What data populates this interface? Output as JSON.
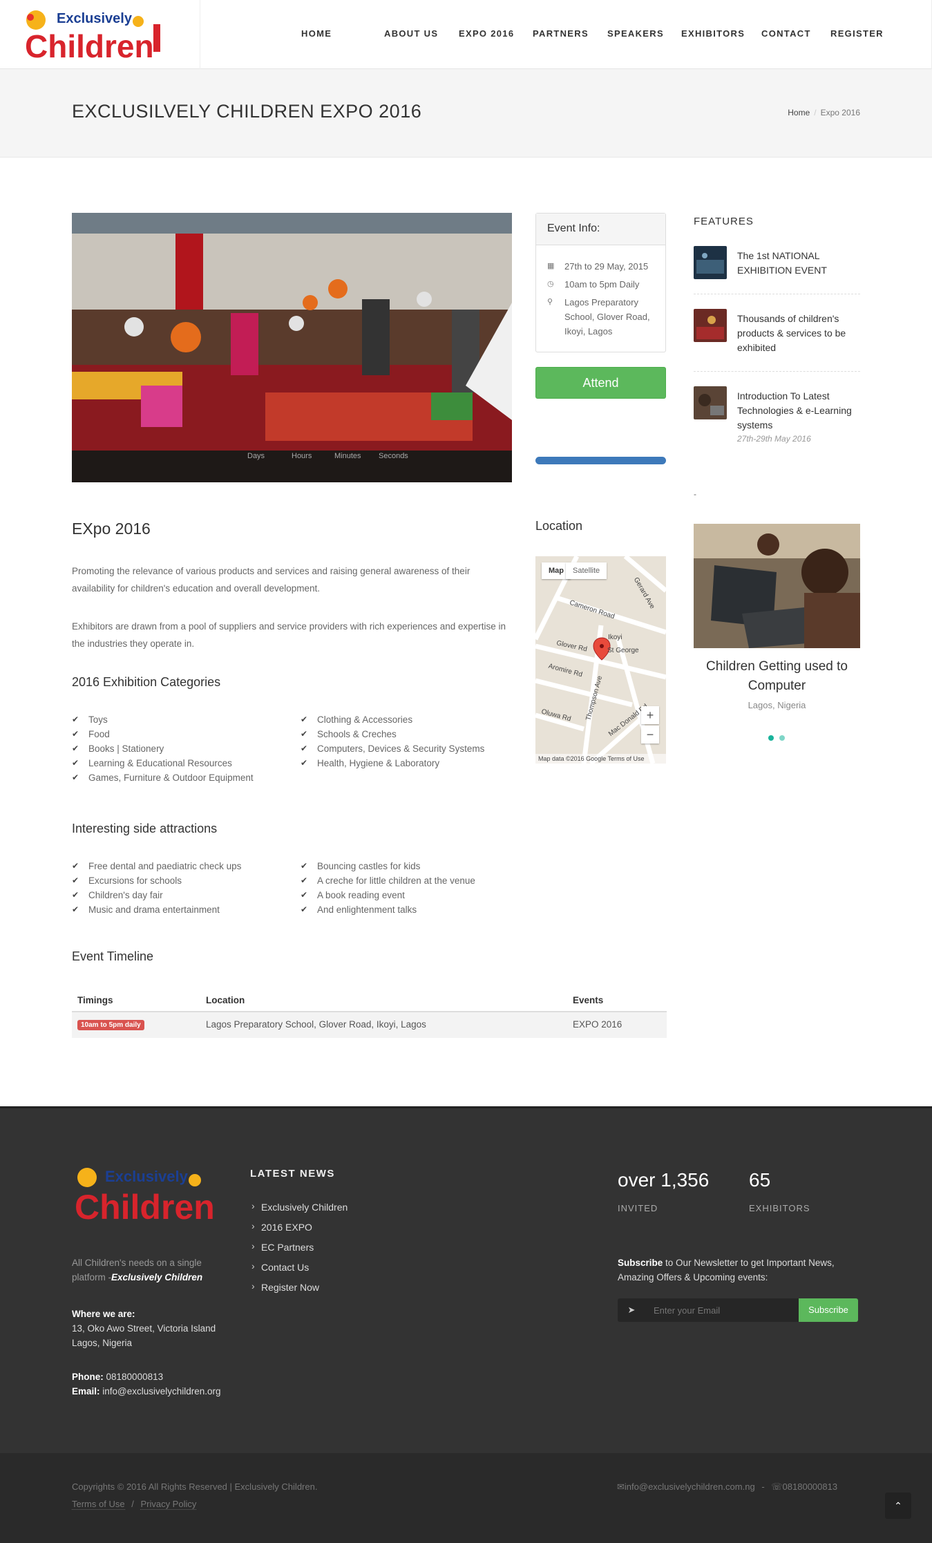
{
  "brand": {
    "logo_word": "Children",
    "logo_prefix": "Exclusively"
  },
  "nav": [
    "HOME",
    "ABOUT US",
    "EXPO 2016",
    "PARTNERS",
    "SPEAKERS",
    "EXHIBITORS",
    "CONTACT",
    "REGISTER"
  ],
  "page": {
    "title": "EXCLUSILVELY CHILDREN EXPO 2016",
    "breadcrumb_home": "Home",
    "breadcrumb_current": "Expo 2016"
  },
  "hero": {
    "countdown_labels": [
      "Days",
      "Hours",
      "Minutes",
      "Seconds"
    ]
  },
  "event_info": {
    "title": "Event Info:",
    "date": "27th to 29 May, 2015",
    "time": "10am to 5pm Daily",
    "address": "Lagos Preparatory School, Glover Road, Ikoyi, Lagos"
  },
  "attend_label": "Attend",
  "features": {
    "title": "FEATURES",
    "items": [
      {
        "text": "The 1st NATIONAL EXHIBITION EVENT"
      },
      {
        "text": "Thousands of children's products & services to be exhibited"
      },
      {
        "text": "Introduction To Latest Technologies & e-Learning systems",
        "date": "27th-29th May 2016"
      }
    ],
    "dash": "-"
  },
  "expo": {
    "title": "EXpo 2016",
    "para1": "Promoting the relevance of various products and services and raising general awareness of their availability for children's education and overall development.",
    "para2": "Exhibitors are drawn from a pool of suppliers and service providers with rich experiences and expertise in the industries they operate in."
  },
  "categories": {
    "title": "2016 Exhibition Categories",
    "left": [
      "Toys",
      "Food",
      "Books | Stationery",
      "Learning & Educational Resources",
      "Games, Furniture & Outdoor Equipment"
    ],
    "right": [
      "Clothing & Accessories",
      "Schools & Creches",
      "Computers, Devices & Security Systems",
      "Health, Hygiene & Laboratory"
    ]
  },
  "attractions": {
    "title": "Interesting side attractions",
    "left": [
      "Free dental and paediatric check ups",
      "Excursions for schools",
      "Children's day fair",
      "Music and drama entertainment"
    ],
    "right": [
      "Bouncing castles for kids",
      "A creche for little children at the venue",
      "A book reading event",
      "And enlightenment talks"
    ]
  },
  "location": {
    "title": "Location",
    "map_tab": "Map",
    "satellite_tab": "Satellite",
    "streets": [
      "Cameron Road",
      "Glover Rd",
      "Aromire Rd",
      "Thompson Ave",
      "Oluwa Rd",
      "Mac Donald Rd",
      "Gerard Ave",
      "Ikoyi",
      "St George"
    ],
    "zoom_in": "+",
    "zoom_out": "−",
    "map_footer": "Map data ©2016 Google   Terms of Use"
  },
  "slider": {
    "caption": "Children Getting used to Computer",
    "location": "Lagos, Nigeria"
  },
  "timeline": {
    "title": "Event Timeline",
    "headers": [
      "Timings",
      "Location",
      "Events"
    ],
    "row": {
      "badge": "10am to 5pm daily",
      "location": "Lagos Preparatory School, Glover Road, Ikoyi, Lagos",
      "event": "EXPO 2016"
    }
  },
  "footer": {
    "about": "All Children's needs on a single platform -",
    "about_em": "Exclusively Children",
    "where_label": "Where we are:",
    "address1": "13, Oko Awo Street, Victoria Island",
    "address2": "Lagos, Nigeria",
    "phone_label": "Phone:",
    "phone": "08180000813",
    "email_label": "Email:",
    "email": "info@exclusivelychildren.org",
    "news_title": "LATEST NEWS",
    "news": [
      "Exclusively Children",
      "2016 EXPO",
      "EC Partners",
      "Contact Us",
      "Register Now"
    ],
    "stat1_num": "over 1,356",
    "stat1_label": "INVITED",
    "stat2_num": "65",
    "stat2_label": "EXHIBITORS",
    "subscribe_bold": "Subscribe",
    "subscribe_text": "to Our Newsletter to get Important News, Amazing Offers & Upcoming events:",
    "email_placeholder": "Enter your Email",
    "subscribe_btn": "Subscribe"
  },
  "copyright": {
    "text": "Copyrights © 2016 All Rights Reserved | Exclusively Children.",
    "terms": "Terms of Use",
    "slash": "/",
    "privacy": "Privacy Policy",
    "contact_email": "info@exclusivelychildren.com.ng",
    "contact_sep": "-",
    "contact_phone": "08180000813"
  },
  "colors": {
    "accent_green": "#5cb85c",
    "badge_red": "#d9534f",
    "progress_blue": "#3d79ba",
    "footer_bg": "#333333"
  }
}
